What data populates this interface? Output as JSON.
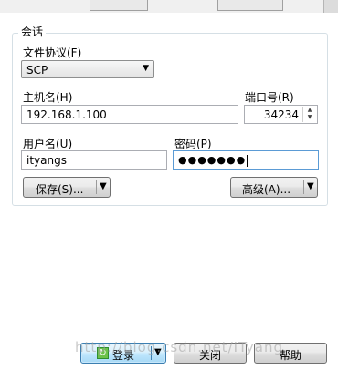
{
  "session": {
    "group_title": "会话",
    "protocol_label": "文件协议(F)",
    "protocol_value": "SCP",
    "host_label": "主机名(H)",
    "host_value": "192.168.1.100",
    "port_label": "端口号(R)",
    "port_value": "34234",
    "user_label": "用户名(U)",
    "user_value": "ityangs",
    "password_label": "密码(P)",
    "password_mask": "●●●●●●●",
    "save_label": "保存(S)...",
    "advanced_label": "高级(A)..."
  },
  "footer": {
    "login_label": "登录",
    "close_label": "关闭",
    "help_label": "帮助"
  },
  "watermark": "http://blog.csdn.net/ITyang"
}
